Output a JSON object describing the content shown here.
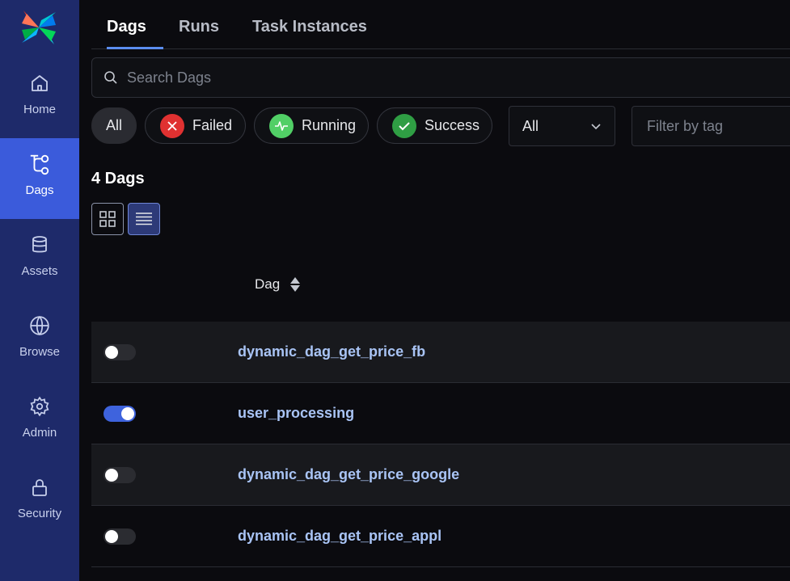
{
  "sidebar": {
    "items": [
      {
        "label": "Home",
        "icon": "home-icon"
      },
      {
        "label": "Dags",
        "icon": "dags-icon",
        "active": true
      },
      {
        "label": "Assets",
        "icon": "database-icon"
      },
      {
        "label": "Browse",
        "icon": "globe-icon"
      },
      {
        "label": "Admin",
        "icon": "gear-icon"
      },
      {
        "label": "Security",
        "icon": "lock-icon"
      }
    ]
  },
  "tabs": [
    {
      "label": "Dags",
      "active": true
    },
    {
      "label": "Runs"
    },
    {
      "label": "Task Instances"
    }
  ],
  "search": {
    "placeholder": "Search Dags"
  },
  "filters": {
    "all": "All",
    "failed": "Failed",
    "running": "Running",
    "success": "Success",
    "dropdown_value": "All",
    "tag_placeholder": "Filter by tag"
  },
  "colors": {
    "failed": "#e03131",
    "running": "#51cf66",
    "success": "#2f9e44",
    "accent": "#3b5bdb",
    "link": "#a9c4f5"
  },
  "dag_count": "4 Dags",
  "table": {
    "column": "Dag",
    "rows": [
      {
        "name": "dynamic_dag_get_price_fb",
        "enabled": false
      },
      {
        "name": "user_processing",
        "enabled": true
      },
      {
        "name": "dynamic_dag_get_price_google",
        "enabled": false
      },
      {
        "name": "dynamic_dag_get_price_appl",
        "enabled": false
      }
    ]
  }
}
